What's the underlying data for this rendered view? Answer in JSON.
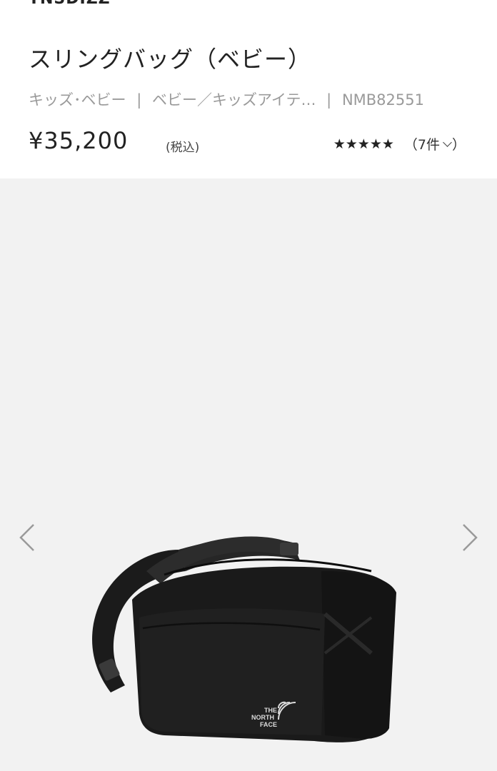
{
  "header": {
    "top_cut_text": "TNSDIZZ"
  },
  "product": {
    "title": "スリングバッグ（ベビー）",
    "category_1": "キッズ･ベビー",
    "category_2": "ベビー／キッズアイテ…",
    "product_code": "NMB82551",
    "separator": "|",
    "price": "¥35,200",
    "tax_label": "(税込)",
    "stars": "★★★★★",
    "review_count": "（7件",
    "review_close": "）"
  },
  "gallery": {
    "prev_icon": "chevron-left-icon",
    "next_icon": "chevron-right-icon",
    "logo_text_1": "THE",
    "logo_text_2": "NORTH",
    "logo_text_3": "FACE"
  },
  "colors": {
    "text_primary": "#222222",
    "text_muted": "#9a9a9a",
    "gallery_bg": "#f2f2f2",
    "bag_color": "#1a1a1a"
  }
}
